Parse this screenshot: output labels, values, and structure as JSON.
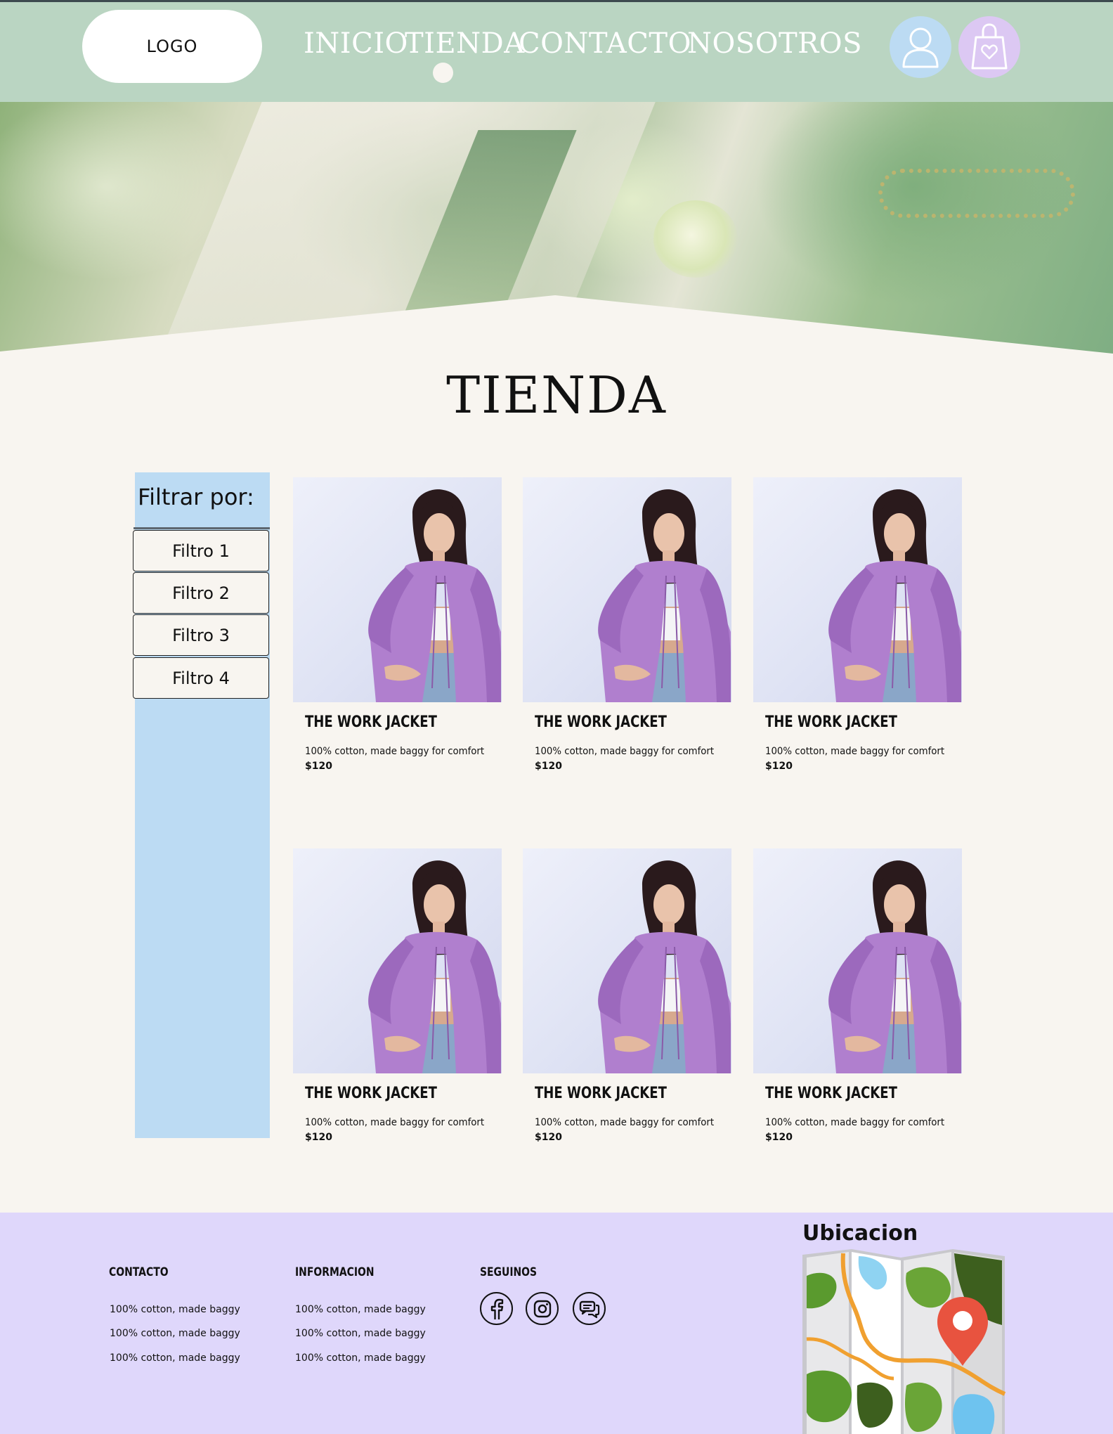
{
  "header": {
    "logo": "LOGO",
    "nav": [
      "INICIO",
      "TIENDA",
      "CONTACTO",
      "NOSOTROS"
    ],
    "active_nav": "TIENDA"
  },
  "page": {
    "title": "TIENDA"
  },
  "filters": {
    "heading": "Filtrar por:",
    "items": [
      "Filtro 1",
      "Filtro 2",
      "Filtro 3",
      "Filtro 4"
    ]
  },
  "products": [
    {
      "name": "THE WORK JACKET",
      "desc": "100% cotton, made baggy for comfort",
      "price": "$120"
    },
    {
      "name": "THE WORK JACKET",
      "desc": "100% cotton, made baggy for comfort",
      "price": "$120"
    },
    {
      "name": "THE WORK JACKET",
      "desc": "100% cotton, made baggy for comfort",
      "price": "$120"
    },
    {
      "name": "THE WORK JACKET",
      "desc": "100% cotton, made baggy for comfort",
      "price": "$120"
    },
    {
      "name": "THE WORK JACKET",
      "desc": "100% cotton, made baggy for comfort",
      "price": "$120"
    },
    {
      "name": "THE WORK JACKET",
      "desc": "100% cotton, made baggy for comfort",
      "price": "$120"
    }
  ],
  "footer": {
    "contacto": {
      "heading": "CONTACTO",
      "links": [
        "100% cotton, made baggy",
        "100% cotton, made baggy",
        "100% cotton, made baggy"
      ]
    },
    "informacion": {
      "heading": "INFORMACION",
      "links": [
        "100% cotton, made baggy",
        "100% cotton, made baggy",
        "100% cotton, made baggy"
      ]
    },
    "seguinos": {
      "heading": "SEGUINOS",
      "icons": [
        "facebook-icon",
        "instagram-icon",
        "chat-icon"
      ]
    },
    "map_title": "Ubicacion"
  },
  "colors": {
    "header_bg": "#bad5c2",
    "page_bg": "#f8f5f0",
    "filter_bg": "#bcdbf3",
    "footer_bg": "#dfd7fb",
    "user_icon_bg": "#bcdbf3",
    "cart_icon_bg": "#dcc8f3"
  }
}
